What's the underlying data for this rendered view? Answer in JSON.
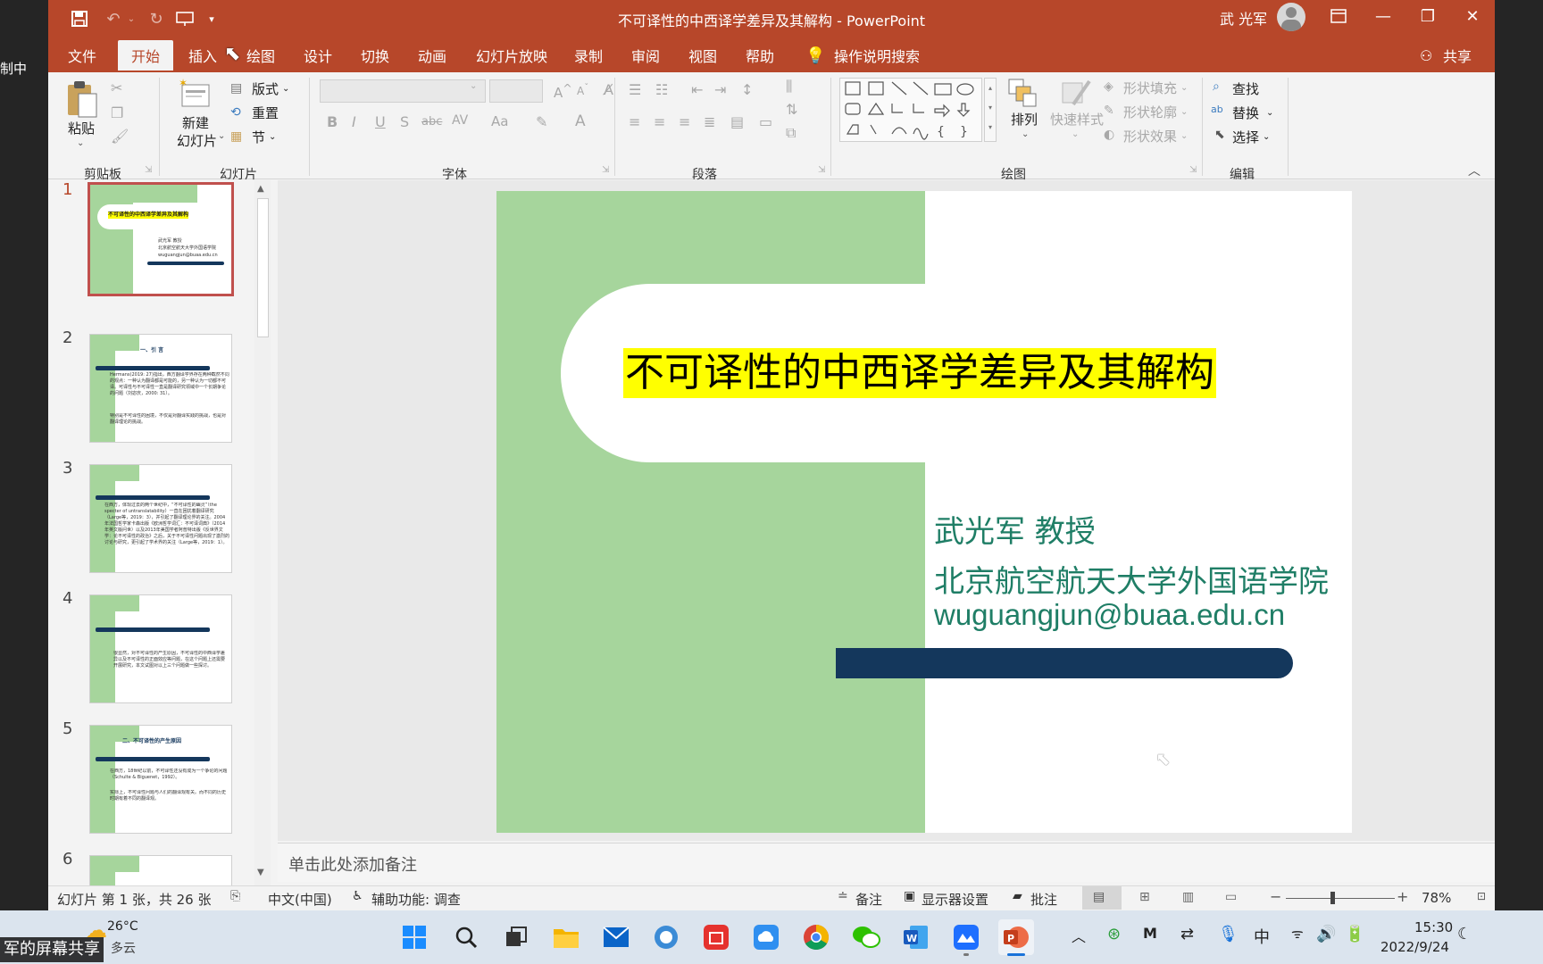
{
  "window": {
    "title": "不可译性的中西译学差异及其解构  -  PowerPoint",
    "user": "武 光军"
  },
  "left_label": "制中",
  "tabs": [
    "文件",
    "开始",
    "插入",
    "绘图",
    "设计",
    "切换",
    "动画",
    "幻灯片放映",
    "录制",
    "审阅",
    "视图",
    "帮助"
  ],
  "tell_me": "操作说明搜索",
  "share": "共享",
  "ribbon": {
    "clipboard": {
      "paste": "粘贴",
      "group": "剪贴板"
    },
    "slides": {
      "new_slide_1": "新建",
      "new_slide_2": "幻灯片",
      "layout": "版式",
      "reset": "重置",
      "section": "节",
      "group": "幻灯片"
    },
    "font": {
      "group": "字体",
      "bold": "B",
      "italic": "I",
      "underline": "U",
      "shadow": "S",
      "strike": "abc",
      "av": "AV",
      "aa": "Aa",
      "a": "A"
    },
    "paragraph": {
      "group": "段落"
    },
    "drawing": {
      "arrange": "排列",
      "quick_styles": "快速样式",
      "fill": "形状填充",
      "outline": "形状轮廓",
      "effects": "形状效果",
      "group": "绘图"
    },
    "editing": {
      "find": "查找",
      "replace": "替换",
      "select": "选择",
      "group": "编辑"
    }
  },
  "thumbnails": [
    {
      "num": "1",
      "title": "不可译性的中西译学差异及其解构",
      "lines": [
        "武光军 教授",
        "北京航空航天大学外国语学院",
        "wuguangjun@buaa.edu.cn"
      ]
    },
    {
      "num": "2",
      "title": "一、引 言",
      "lines": [
        "Hermans(2019: 27)指出，西方翻译学界存在两种截然不同的观点：一种认为翻译都是可能的，另一种认为一切都不可译。可译性与不可译性一直是翻译研究领域中一个长期争论的问题（刘宓庆，2000: 31）。",
        "特别是不可译性的困境，不仅是对翻译实践的挑战，也是对翻译理论的挑战。"
      ]
    },
    {
      "num": "3",
      "title": "",
      "lines": [
        "在西方，体现过去的两个世纪中，“不可译性的幽灵”（the specter of untranslatability）一直在困扰着翻译研究（Large等，2019：3），并引起了翻译理论界的关注。2004年法国哲学家卡森出版《欧洲哲学词汇：不可译词典》（2014年英文版问世）以及2013年美国学者阿普特出版《反世界文学：论不可译性的政治》之后，关于不可译性问题出现了激烈的讨论与研究，更引起了学术界的关注（Large等，2019：1）。"
      ]
    },
    {
      "num": "4",
      "title": "",
      "lines": [
        "很显然，对不可译性的产生原因，不可译性的中西译学差异以及不可译性的正面效应等问题，在这个问题上还需要开展研究，本文试图对以上三个问题做一些探讨。"
      ]
    },
    {
      "num": "5",
      "title": "二、不可译性的产生原因",
      "lines": [
        "在西方，18世纪以前，不可译性还没有成为一个争论的问题（Schulte & Biguenet，1992）。",
        "实际上，不可译性问题与人们的翻译观有关。而不同的历史时期有着不同的翻译观。"
      ]
    },
    {
      "num": "6"
    }
  ],
  "slide": {
    "title": "不可译性的中西译学差异及其解构",
    "author": "武光军 教授",
    "affiliation": "北京航空航天大学外国语学院",
    "email": "wuguangjun@buaa.edu.cn"
  },
  "notes_placeholder": "单击此处添加备注",
  "status": {
    "slide_info": "幻灯片 第 1 张，共 26 张",
    "language": "中文(中国)",
    "accessibility": "辅助功能: 调查",
    "notes": "备注",
    "display": "显示器设置",
    "comments": "批注",
    "zoom": "78%"
  },
  "taskbar": {
    "weather_temp": "26°C",
    "weather_desc": "多云",
    "share_banner": "军的屏幕共享",
    "ime": "中",
    "time": "15:30",
    "date": "2022/9/24"
  },
  "colors": {
    "accent": "#b7472a",
    "slide_green": "#a6d59c",
    "slide_navy": "#14375c",
    "slide_teal": "#1f7e66",
    "highlight": "#ffff00"
  }
}
